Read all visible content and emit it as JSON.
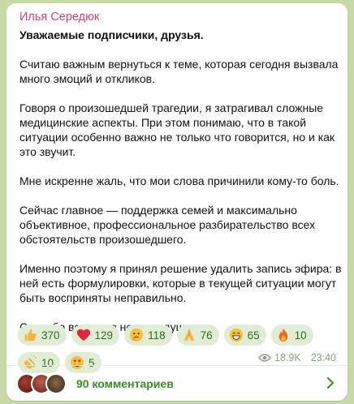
{
  "post": {
    "author": "Илья Середюк",
    "title": "Уважаемые подписчики, друзья.",
    "paragraphs": [
      "Считаю важным вернуться к теме, которая сегодня вызвала много эмоций и откликов.",
      "Говоря о произошедшей трагедии, я затрагивал сложные медицинские аспекты. При этом понимаю, что в такой ситуации особенно важно не только что говорится, но и как это звучит.",
      "Мне искренне жаль, что мои слова причинили кому-то боль.",
      "Сейчас главное — поддержка семей и максимально объективное, профессиональное разбирательство всех обстоятельств произошедшего.",
      "Именно поэтому я принял решение удалить запись эфира: в ней есть формулировки, которые в текущей ситуации могут быть восприняты неправильно.",
      "Спасибо всем, кто неравнодушен."
    ],
    "views": "18.9K",
    "time": "23:40"
  },
  "reactions": [
    {
      "icon": "thumbs-up-icon",
      "count": "370",
      "color": "#f5b53a"
    },
    {
      "icon": "red-heart-icon",
      "count": "129",
      "color": "#e0263a"
    },
    {
      "icon": "thinking-face-icon",
      "count": "118",
      "color": "#f5c23a"
    },
    {
      "icon": "folded-hands-icon",
      "count": "76",
      "color": "#f2b94a"
    },
    {
      "icon": "grinning-face-icon",
      "count": "65",
      "color": "#f5c23a"
    },
    {
      "icon": "fire-icon",
      "count": "10",
      "color": "#f06a1d"
    },
    {
      "icon": "clapping-hands-icon",
      "count": "10",
      "color": "#f5b53a"
    },
    {
      "icon": "heart-eyes-face-icon",
      "count": "5",
      "color": "#f5c23a"
    }
  ],
  "comments": {
    "label": "90 комментариев"
  },
  "colors": {
    "author": "#c8407d",
    "accent": "#3a8a2a",
    "reaction_bg": "#e1ecd5",
    "chat_bg": "#c8d9a8"
  }
}
